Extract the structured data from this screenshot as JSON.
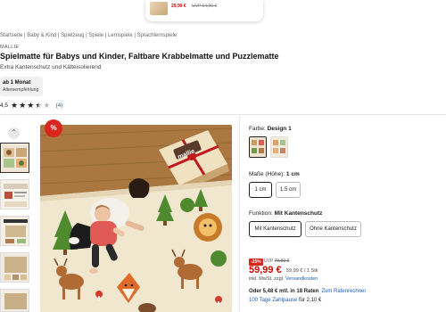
{
  "top_card": {
    "price": "29,99 €",
    "uvp": "UVP 64,90 €"
  },
  "breadcrumb": "Startseite | Baby & Kind | Spielzeug | Spiele | Lernspiele | Sprachlernspiele",
  "brand": "MALLIE",
  "title": "Spielmatte für Babys und Kinder, Faltbare Krabbelmatte und Puzzlematte",
  "subtitle": "Extra Kantenschutz und Kälteisolierend",
  "age_badge": {
    "value": "ab 1 Monat",
    "label": "Altersempfehlung"
  },
  "rating": {
    "value": "4,5",
    "stars": 3.5,
    "count": "(4)"
  },
  "discount_badge": "%",
  "product_image": {
    "box_label": "mallie"
  },
  "variants": {
    "color_label": "Farbe:",
    "color_value": "Design 1",
    "size_label": "Maße (Höhe):",
    "size_value": "1 cm",
    "size_options": [
      "1 cm",
      "1.5 cm"
    ],
    "function_label": "Funktion:",
    "function_value": "Mit Kantenschutz",
    "function_options": [
      "Mit Kantenschutz",
      "Ohne Kantenschutz"
    ]
  },
  "pricing": {
    "discount": "-25%",
    "uvp_label": "UVP",
    "uvp_value": "79,90 €",
    "price": "59,99 €",
    "unit_price": "59,99 € / 1 Stk",
    "tax": "inkl. MwSt. zzgl.",
    "shipping_link": "Versandkosten",
    "finance": "Oder 5,48 € mtl. in 18 Raten",
    "finance_link": "Zum Ratenrechner",
    "pay_later": "100 Tage Zahlpause",
    "pay_later_suffix": "für 2,10 €"
  },
  "colors": {
    "accent_red": "#d8261c",
    "price_red": "#d40000",
    "link_blue": "#1a5fb4"
  }
}
